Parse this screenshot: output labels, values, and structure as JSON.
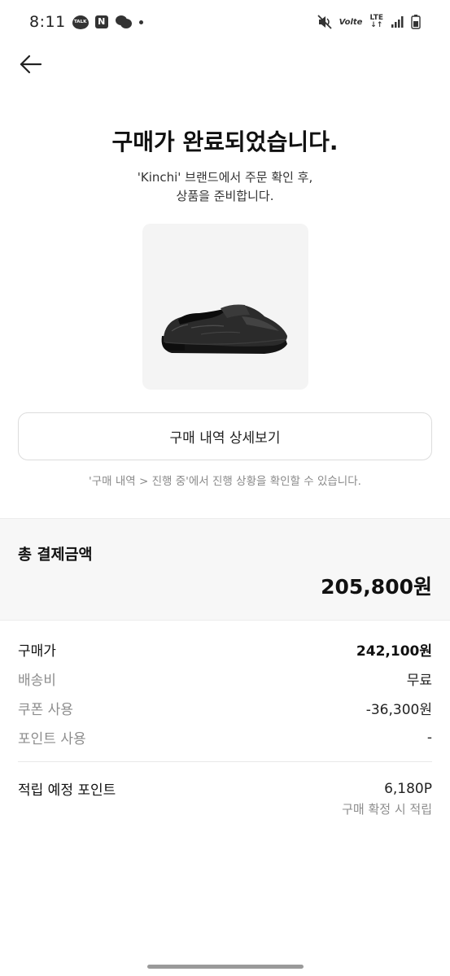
{
  "status_bar": {
    "time": "8:11",
    "talk_label": "TALK",
    "n_label": "N",
    "volte_label": "Volte",
    "lte_label": "LTE"
  },
  "header": {
    "back_icon": "arrow-left-icon"
  },
  "completion": {
    "title": "구매가 완료되었습니다.",
    "subtitle_line1": "'Kinchi' 브랜드에서 주문 확인 후,",
    "subtitle_line2": "상품을 준비합니다."
  },
  "product": {
    "image_icon": "black-leather-loafer-image"
  },
  "actions": {
    "detail_button_label": "구매 내역 상세보기",
    "hint_text": "'구매 내역 > 진행 중'에서 진행 상황을 확인할 수 있습니다."
  },
  "total": {
    "label": "총 결제금액",
    "amount": "205,800원"
  },
  "breakdown": [
    {
      "label": "구매가",
      "value": "242,100원"
    },
    {
      "label": "배송비",
      "value": "무료"
    },
    {
      "label": "쿠폰 사용",
      "value": "-36,300원"
    },
    {
      "label": "포인트 사용",
      "value": "-"
    }
  ],
  "points": {
    "label": "적립 예정 포인트",
    "value": "6,180P",
    "note": "구매 확정 시 적립"
  }
}
